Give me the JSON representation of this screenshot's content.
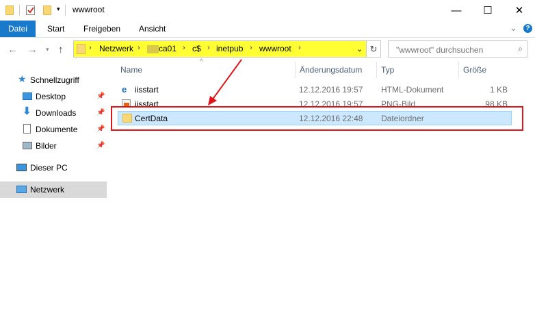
{
  "window": {
    "title": "wwwroot",
    "controls": {
      "minimize": "—",
      "maximize": "☐",
      "close": "✕"
    }
  },
  "ribbon": {
    "tabs": [
      {
        "label": "Datei",
        "active": true
      },
      {
        "label": "Start"
      },
      {
        "label": "Freigeben"
      },
      {
        "label": "Ansicht"
      }
    ],
    "expand_icon": "chevron-down-icon",
    "help_icon": "help-icon"
  },
  "address": {
    "breadcrumbs": [
      "Netzwerk",
      "ca01",
      "c$",
      "inetpub",
      "wwwroot"
    ],
    "highlight_color": "#ffff33",
    "search_placeholder": "\"wwwroot\" durchsuchen"
  },
  "sidebar": {
    "items": [
      {
        "label": "Schnellzugriff",
        "icon": "star-icon"
      },
      {
        "label": "Desktop",
        "icon": "desktop-icon",
        "pinned": true
      },
      {
        "label": "Downloads",
        "icon": "download-icon",
        "pinned": true
      },
      {
        "label": "Dokumente",
        "icon": "document-icon",
        "pinned": true
      },
      {
        "label": "Bilder",
        "icon": "pictures-icon",
        "pinned": true
      },
      {
        "label": "Dieser PC",
        "icon": "computer-icon"
      },
      {
        "label": "Netzwerk",
        "icon": "network-icon",
        "selected": true
      }
    ]
  },
  "columns": {
    "name": "Name",
    "date": "Änderungsdatum",
    "type": "Typ",
    "size": "Größe"
  },
  "files": [
    {
      "name": "iisstart",
      "date": "12.12.2016 19:57",
      "type": "HTML-Dokument",
      "size": "1 KB",
      "icon": "html-file-icon"
    },
    {
      "name": "iisstart",
      "date": "12.12.2016 19:57",
      "type": "PNG-Bild",
      "size": "98 KB",
      "icon": "image-file-icon"
    },
    {
      "name": "CertData",
      "date": "12.12.2016 22:48",
      "type": "Dateiordner",
      "size": "",
      "icon": "folder-icon",
      "selected": true
    }
  ],
  "annotation": {
    "color": "#e0151a"
  }
}
